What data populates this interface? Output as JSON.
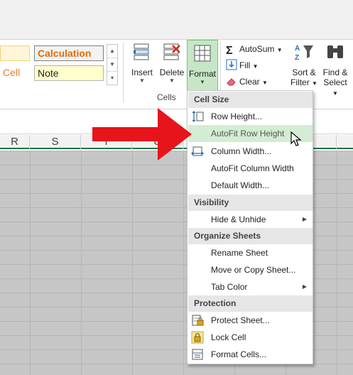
{
  "styles_gallery": {
    "cell_partial_top": "",
    "cell_partial": "Cell",
    "calculation": "Calculation",
    "note": "Note"
  },
  "ribbon": {
    "insert_label": "Insert",
    "delete_label": "Delete",
    "format_label": "Format",
    "cells_group_label": "Cells",
    "autosum_label": "AutoSum",
    "fill_label": "Fill",
    "clear_label": "Clear",
    "sort_filter_line1": "Sort &",
    "sort_filter_line2": "Filter",
    "find_select_line1": "Find &",
    "find_select_line2": "Select"
  },
  "columns": [
    "R",
    "S",
    "T",
    "U",
    "",
    "",
    ""
  ],
  "menu": {
    "sections": [
      {
        "header": "Cell Size",
        "items": [
          {
            "label": "Row Height...",
            "icon": "row-height-icon",
            "submenu": false
          },
          {
            "label": "AutoFit Row Height",
            "icon": "",
            "submenu": false,
            "hover": true
          },
          {
            "label": "Column Width...",
            "icon": "column-width-icon",
            "submenu": false
          },
          {
            "label": "AutoFit Column Width",
            "icon": "",
            "submenu": false
          },
          {
            "label": "Default Width...",
            "icon": "",
            "submenu": false
          }
        ]
      },
      {
        "header": "Visibility",
        "items": [
          {
            "label": "Hide & Unhide",
            "icon": "",
            "submenu": true
          }
        ]
      },
      {
        "header": "Organize Sheets",
        "items": [
          {
            "label": "Rename Sheet",
            "icon": "",
            "submenu": false
          },
          {
            "label": "Move or Copy Sheet...",
            "icon": "",
            "submenu": false
          },
          {
            "label": "Tab Color",
            "icon": "",
            "submenu": true
          }
        ]
      },
      {
        "header": "Protection",
        "items": [
          {
            "label": "Protect Sheet...",
            "icon": "protect-sheet-icon",
            "submenu": false
          },
          {
            "label": "Lock Cell",
            "icon": "lock-icon",
            "submenu": false
          },
          {
            "label": "Format Cells...",
            "icon": "format-cells-icon",
            "submenu": false
          }
        ]
      }
    ]
  },
  "colors": {
    "accent_green": "#217346",
    "hover_green": "#d4ecd4",
    "annotation_red": "#e8141b"
  }
}
